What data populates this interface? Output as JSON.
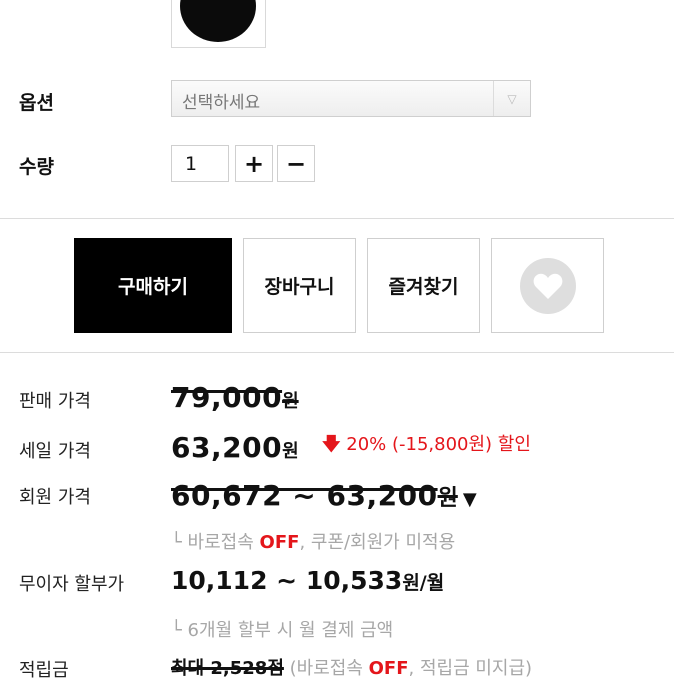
{
  "product": {
    "option": {
      "label": "옵션",
      "placeholder": "선택하세요",
      "arrow": "▽"
    },
    "quantity": {
      "label": "수량",
      "value": "1",
      "plus": "+",
      "minus": "−"
    }
  },
  "actions": {
    "buy": "구매하기",
    "cart": "장바구니",
    "favorites": "즐겨찾기",
    "like_icon": "heart-icon"
  },
  "pricing": {
    "sale_price": {
      "label": "판매 가격",
      "value": "79,000",
      "unit": "원"
    },
    "discount_price": {
      "label": "세일 가격",
      "value": "63,200",
      "unit": "원",
      "arrow": "🡇",
      "discount": "20% (-15,800원) 할인"
    },
    "member_price": {
      "label": "회원 가격",
      "value": "60,672 ~ 63,200",
      "unit": "원",
      "caret": "▼",
      "note_prefix": "└ 바로접속 ",
      "note_flag": "OFF",
      "note_suffix": ", 쿠폰/회원가 미적용"
    },
    "installment": {
      "label": "무이자 할부가",
      "value": "10,112 ~ 10,533",
      "unit": "원/월",
      "note": "└ 6개월 할부 시 월 결제 금액"
    },
    "points": {
      "label": "적립금",
      "value": "최대 2,528점",
      "note_prefix": "(바로접속 ",
      "note_flag": "OFF",
      "note_suffix": ", 적립금 미지급)"
    }
  },
  "colors": {
    "accent": "#e4161b",
    "primary_button": "#000000",
    "muted": "#a7a7a7"
  }
}
